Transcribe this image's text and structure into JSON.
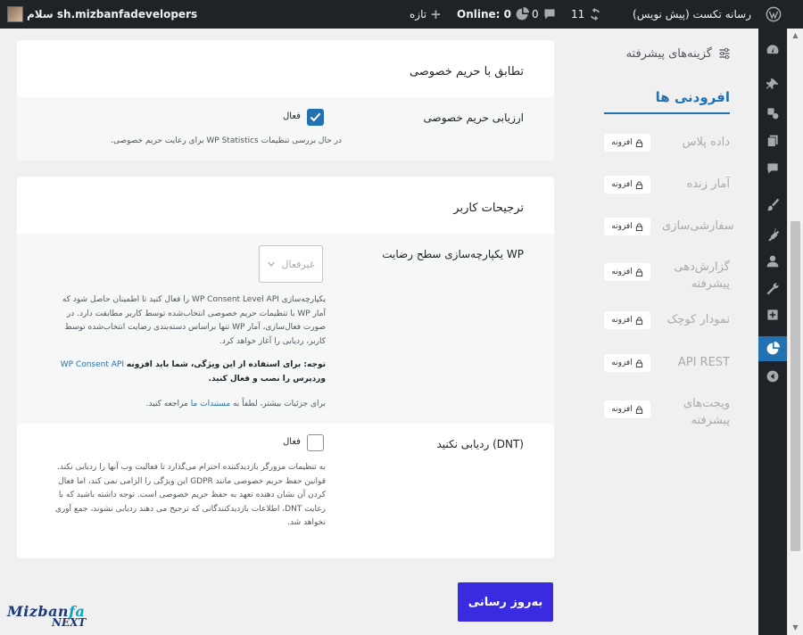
{
  "adminbar": {
    "site_title": "رسانه تکست (پیش نویس)",
    "updates_count": "11",
    "comments_count": "0",
    "online": "Online: 0",
    "new_label": "تازه",
    "greeting": "سلام sh.mizbanfadevelopers"
  },
  "nav": {
    "advanced_options": "گزینه‌های پیشرفته",
    "addons_title": "افرودنی ها",
    "badge_label": "افزونه",
    "addons": [
      {
        "name": "داده پلاس",
        "badge": "افزونه"
      },
      {
        "name": "آمار زنده",
        "badge": "افزونه"
      },
      {
        "name": "سفارشی‌سازی",
        "badge": "افزونه"
      },
      {
        "name": "گزارش‌دهی پیشرفته",
        "badge": "افزونه"
      },
      {
        "name": "نمودار کوچک",
        "badge": "افزونه"
      },
      {
        "name": "API REST",
        "badge": "افزونه"
      },
      {
        "name": "ویجت‌های پیشرفته",
        "badge": "افزونه"
      }
    ]
  },
  "privacy_card": {
    "title": "تطابق با حریم خصوصی",
    "audit_label": "ارزیابی حریم خصوصی",
    "audit_checkbox_label": "فعال",
    "audit_checked": true,
    "audit_desc": "در حال بررسی تنظیمات WP Statistics برای رعایت حریم خصوصی."
  },
  "user_card": {
    "title": "ترجیحات کاربر",
    "consent_label": "یکپارچه‌سازی سطح رضایت WP",
    "consent_select_value": "غیرفعال",
    "consent_desc_1": "یکپارچه‌سازی WP Consent Level API را فعال کنید تا اطمینان حاصل شود که آمار WP با تنظیمات حریم خصوصی انتخاب‌شده توسط کاربر مطابقت دارد. در صورت فعال‌سازی، آمار WP تنها براساس دسته‌بندی رضایت انتخاب‌شده توسط کاربر، ردیابی را آغاز خواهد کرد.",
    "consent_note_prefix": "توجه: برای استفاده از این ویژگی، شما باید افزونه",
    "consent_note_link": "WP Consent API",
    "consent_note_suffix": "وردپرس را نصب و فعال کنید.",
    "consent_more_prefix": "برای جزئیات بیشتر، لطفاً به",
    "consent_more_link": "مستندات ما",
    "consent_more_suffix": "مراجعه کنید.",
    "dnt_label": "ردیابی نکنید (DNT)",
    "dnt_checkbox_label": "فعال",
    "dnt_checked": false,
    "dnt_desc": "به تنظیمات مرورگر بازدیدکننده احترام می‌گذارد تا فعالیت وب آنها را ردیابی نکند. قوانین حفظ حریم خصوصی مانند GDPR این ویژگی را الزامی نمی کند، اما فعال کردن آن نشان دهنده تعهد به حفظ حریم خصوصی است. توجه داشته باشید که با رعایت DNT، اطلاعات بازدیدکنندگانی که ترجیح می دهند ردیابی نشوند، جمع آوری نخواهد شد."
  },
  "update_button": "به‌روز رسانی",
  "logo": {
    "line1": "Mizbanfa",
    "line2": "NEXT"
  },
  "colors": {
    "accent": "#2271b1",
    "button": "#3b2be0",
    "adminbar": "#1d2327"
  }
}
